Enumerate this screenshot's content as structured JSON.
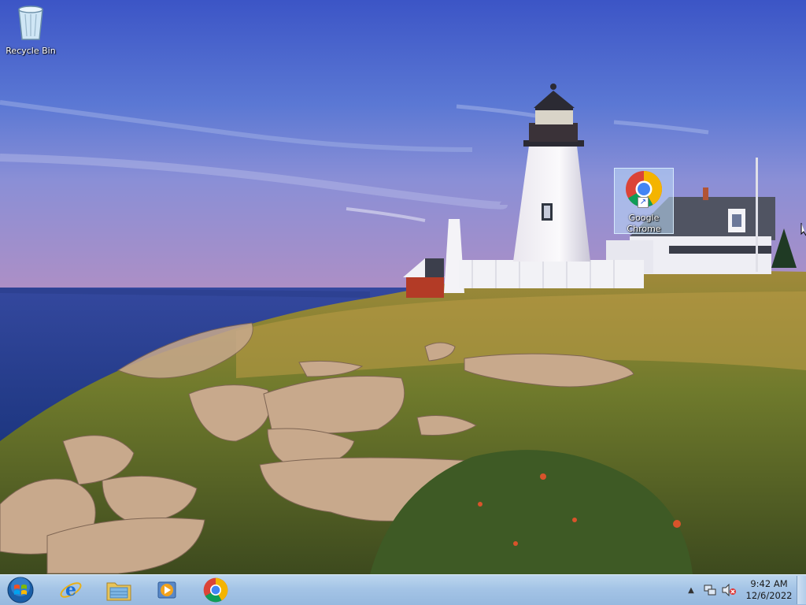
{
  "desktop": {
    "icons": [
      {
        "label": "Recycle Bin",
        "icon": "recycle-bin-icon"
      },
      {
        "label": "Google Chrome",
        "icon": "chrome-icon",
        "selected": true
      }
    ]
  },
  "taskbar": {
    "start_icon": "windows-start-orb-icon",
    "pinned": [
      {
        "icon": "internet-explorer-icon"
      },
      {
        "icon": "file-explorer-icon"
      },
      {
        "icon": "media-player-icon"
      },
      {
        "icon": "chrome-icon"
      }
    ],
    "tray": {
      "icons": [
        "show-hidden-icons-chevron-icon",
        "network-icon",
        "volume-muted-icon"
      ],
      "time": "9:42 AM",
      "date": "12/6/2022"
    }
  },
  "colors": {
    "taskbar": "#a4c4e6",
    "selection": "#bedcfa",
    "sky": "#3f5fc8",
    "sea": "#243f9a"
  }
}
